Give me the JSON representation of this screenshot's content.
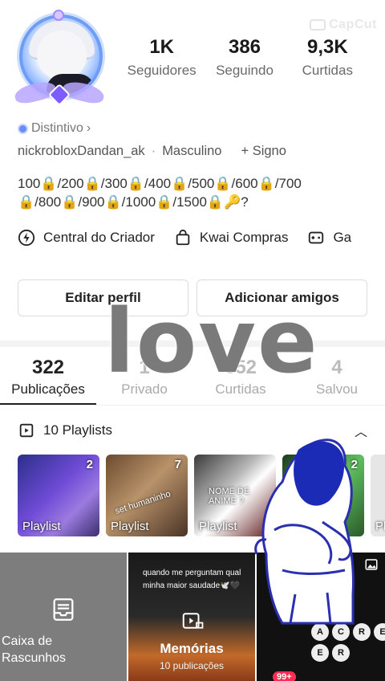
{
  "watermark": "CapCut",
  "profile": {
    "stats": [
      {
        "value": "1K",
        "label": "Seguidores"
      },
      {
        "value": "386",
        "label": "Seguindo"
      },
      {
        "value": "9,3K",
        "label": "Curtidas"
      }
    ],
    "badge": "Distintivo",
    "username": "nickrobloxDandan_ak",
    "gender": "Masculino",
    "sign": "+ Signo",
    "bio_line1": "100🔒/200🔒/300🔒/400🔒/500🔒/600🔒/700",
    "bio_line2": "🔒/800🔒/900🔒/1000🔒/1500🔒🔑?"
  },
  "actions": [
    {
      "label": "Central do Criador",
      "icon": "lightning-icon"
    },
    {
      "label": "Kwai Compras",
      "icon": "shopping-bag-icon"
    },
    {
      "label": "Ga",
      "icon": "gamepad-icon"
    }
  ],
  "buttons": {
    "edit": "Editar perfil",
    "add": "Adicionar amigos"
  },
  "overlay_text": "love",
  "tabs": [
    {
      "count": "322",
      "label": "Publicações",
      "active": true
    },
    {
      "count": "1",
      "label": "Privado",
      "active": false
    },
    {
      "count": "652",
      "label": "Curtidas",
      "active": false
    },
    {
      "count": "4",
      "label": "Salvou",
      "active": false
    }
  ],
  "playlists_header": "10 Playlists",
  "playlists": [
    {
      "label": "Playlist",
      "count": "2",
      "overlay": ""
    },
    {
      "label": "Playlist",
      "count": "7",
      "overlay": "set humaninho"
    },
    {
      "label": "Playlist",
      "count": "",
      "overlay": "NOME DE ANIME ?"
    },
    {
      "label": "",
      "count": "2",
      "overlay": ""
    },
    {
      "label": "Pl",
      "count": "",
      "overlay": ""
    }
  ],
  "grid": {
    "drafts_line1": "Caixa de",
    "drafts_line2": "Rascunhos",
    "memories_caption": "quando me perguntam qual minha maior saudade🕊️🖤",
    "memories_title": "Memórias",
    "memories_sub": "10 publicações",
    "keys": [
      "A",
      "C",
      "R",
      "E",
      "E",
      "R"
    ]
  },
  "nav_badge": "99+"
}
